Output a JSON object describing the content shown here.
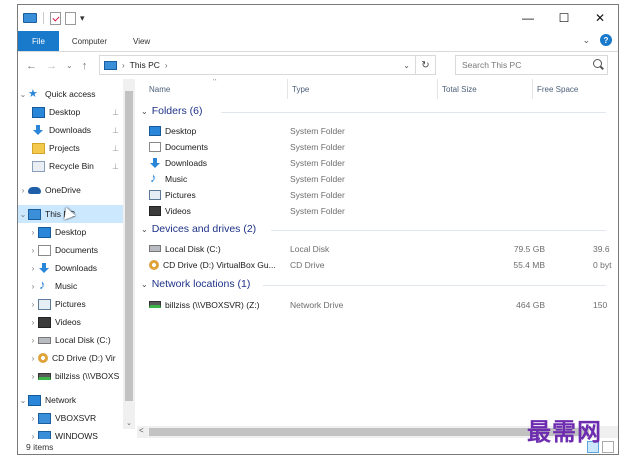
{
  "quick_access_toolbar": {
    "dropdown": "▾"
  },
  "window_controls": {
    "minimize": "—",
    "maximize": "☐",
    "close": "✕"
  },
  "ribbon": {
    "tabs": [
      "File",
      "Computer",
      "View"
    ],
    "expand_chevron": "⌄",
    "help": "?"
  },
  "nav_buttons": {
    "back": "←",
    "forward": "→",
    "recent": "⌄",
    "up": "↑"
  },
  "address": {
    "sep1": "›",
    "location": "This PC",
    "sep2": "›",
    "dropdown": "⌄",
    "refresh": "↻"
  },
  "search": {
    "placeholder": "Search This PC"
  },
  "navigation_pane": {
    "items": [
      {
        "label": "Quick access",
        "icon": "star-icon",
        "expander": "⌄",
        "pinned": false
      },
      {
        "label": "Desktop",
        "icon": "desktop-icon",
        "expander": "",
        "pinned": true
      },
      {
        "label": "Downloads",
        "icon": "downloads-icon",
        "expander": "",
        "pinned": true
      },
      {
        "label": "Projects",
        "icon": "folder-icon",
        "expander": "",
        "pinned": true
      },
      {
        "label": "Recycle Bin",
        "icon": "recycle-bin-icon",
        "expander": "",
        "pinned": true
      },
      {
        "label": "OneDrive",
        "icon": "onedrive-icon",
        "expander": "›",
        "pinned": false
      },
      {
        "label": "This PC",
        "icon": "this-pc-icon",
        "expander": "⌄",
        "pinned": false,
        "selected": true
      },
      {
        "label": "Desktop",
        "icon": "desktop-icon",
        "expander": "›",
        "pinned": false
      },
      {
        "label": "Documents",
        "icon": "documents-icon",
        "expander": "›",
        "pinned": false
      },
      {
        "label": "Downloads",
        "icon": "downloads-icon",
        "expander": "›",
        "pinned": false
      },
      {
        "label": "Music",
        "icon": "music-icon",
        "expander": "›",
        "pinned": false
      },
      {
        "label": "Pictures",
        "icon": "pictures-icon",
        "expander": "›",
        "pinned": false
      },
      {
        "label": "Videos",
        "icon": "videos-icon",
        "expander": "›",
        "pinned": false
      },
      {
        "label": "Local Disk (C:)",
        "icon": "local-disk-icon",
        "expander": "›",
        "pinned": false
      },
      {
        "label": "CD Drive (D:) Vir",
        "icon": "cd-drive-icon",
        "expander": "›",
        "pinned": false
      },
      {
        "label": "billziss (\\\\VBOXS",
        "icon": "network-drive-icon",
        "expander": "›",
        "pinned": false
      },
      {
        "label": "Network",
        "icon": "network-icon",
        "expander": "⌄",
        "pinned": false
      },
      {
        "label": "VBOXSVR",
        "icon": "computer-icon",
        "expander": "›",
        "pinned": false
      },
      {
        "label": "WINDOWS",
        "icon": "computer-icon",
        "expander": "›",
        "pinned": false
      }
    ],
    "pin_glyph": "📌",
    "scroll_down": "⌄"
  },
  "columns": {
    "name": "Name",
    "type": "Type",
    "total_size": "Total Size",
    "free_space": "Free Space",
    "sort_arrow": "^"
  },
  "groups": [
    {
      "title": "Folders (6)",
      "items": [
        {
          "name": "Desktop",
          "icon": "desktop-icon",
          "type": "System Folder",
          "total": "",
          "free": ""
        },
        {
          "name": "Documents",
          "icon": "documents-icon",
          "type": "System Folder",
          "total": "",
          "free": ""
        },
        {
          "name": "Downloads",
          "icon": "downloads-icon",
          "type": "System Folder",
          "total": "",
          "free": ""
        },
        {
          "name": "Music",
          "icon": "music-icon",
          "type": "System Folder",
          "total": "",
          "free": ""
        },
        {
          "name": "Pictures",
          "icon": "pictures-icon",
          "type": "System Folder",
          "total": "",
          "free": ""
        },
        {
          "name": "Videos",
          "icon": "videos-icon",
          "type": "System Folder",
          "total": "",
          "free": ""
        }
      ]
    },
    {
      "title": "Devices and drives (2)",
      "items": [
        {
          "name": "Local Disk (C:)",
          "icon": "local-disk-icon",
          "type": "Local Disk",
          "total": "79.5 GB",
          "free": "39.6"
        },
        {
          "name": "CD Drive (D:) VirtualBox Gu...",
          "icon": "cd-drive-icon",
          "type": "CD Drive",
          "total": "55.4 MB",
          "free": "0 byt"
        }
      ]
    },
    {
      "title": "Network locations (1)",
      "items": [
        {
          "name": "billziss (\\\\VBOXSVR) (Z:)",
          "icon": "network-drive-icon",
          "type": "Network Drive",
          "total": "464 GB",
          "free": "150"
        }
      ]
    }
  ],
  "group_chevron": "⌄",
  "hscroll_left": "<",
  "status": {
    "item_count": "9 items"
  },
  "watermark": "最需网"
}
